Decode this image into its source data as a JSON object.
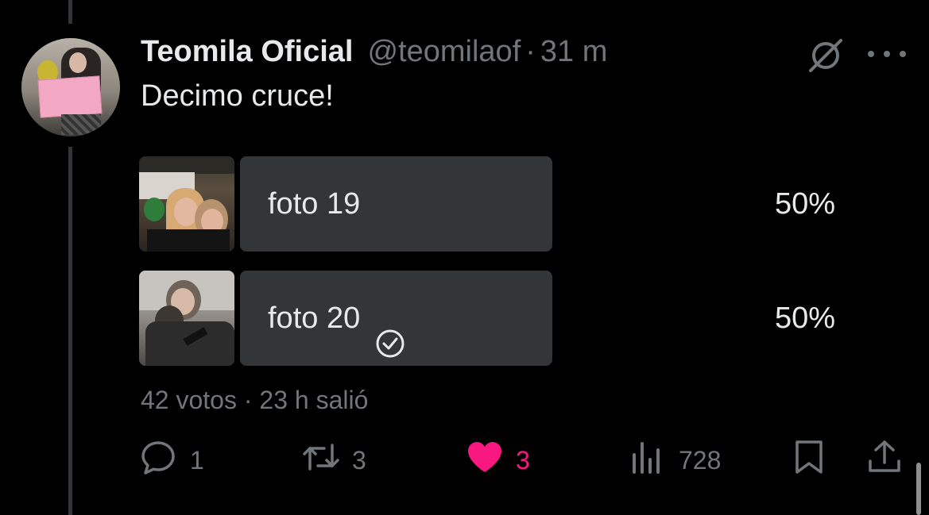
{
  "tweet": {
    "author_name": "Teomila Oficial",
    "handle": "@teomilaof",
    "separator": "·",
    "time": "31 m",
    "text": "Decimo cruce!"
  },
  "poll": {
    "options": [
      {
        "label": "foto 19",
        "percent": "50%",
        "selected": false
      },
      {
        "label": "foto 20",
        "percent": "50%",
        "selected": true
      }
    ],
    "votes": "42 votos",
    "separator": "·",
    "status": "23 h salió"
  },
  "actions": {
    "replies": "1",
    "retweets": "3",
    "likes": "3",
    "views": "728"
  },
  "colors": {
    "background": "#000000",
    "text": "#e7e9ea",
    "muted": "#71767b",
    "poll_bar": "#333639",
    "like": "#f91880"
  },
  "icons": [
    "grok-icon",
    "more-icon",
    "check-circle-icon",
    "reply-icon",
    "retweet-icon",
    "heart-icon",
    "views-icon",
    "bookmark-icon",
    "share-icon"
  ]
}
